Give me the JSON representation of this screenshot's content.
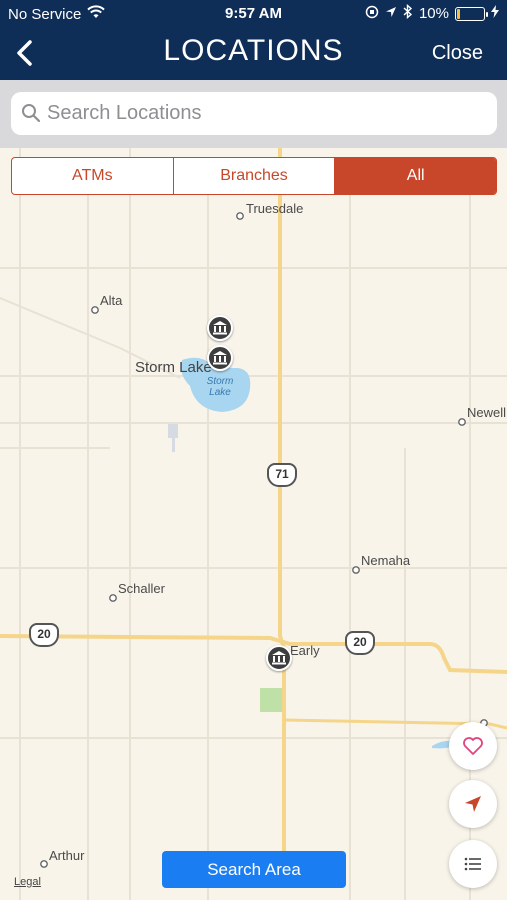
{
  "status_bar": {
    "carrier": "No Service",
    "time": "9:57 AM",
    "battery": "10%",
    "battery_level": 0.1
  },
  "nav": {
    "title": "LOCATIONS",
    "close_label": "Close"
  },
  "search": {
    "placeholder": "Search Locations"
  },
  "filter": {
    "options": [
      "ATMs",
      "Branches",
      "All"
    ],
    "selected": "All"
  },
  "map": {
    "places": [
      "Truesdale",
      "Alta",
      "Storm Lake",
      "Newell",
      "Nemaha",
      "Schaller",
      "Early",
      "Arthur"
    ],
    "lake_label": [
      "Storm",
      "Lake"
    ],
    "routes": [
      "71",
      "20",
      "20"
    ],
    "legal": "Legal"
  },
  "buttons": {
    "search_area": "Search Area",
    "favorites_icon": "heart-icon",
    "locate_icon": "location-arrow-icon",
    "list_icon": "list-icon"
  },
  "colors": {
    "nav_bg": "#0f2e57",
    "accent": "#c8472a",
    "search_area": "#1a7ef2",
    "map_bg": "#f8f4ea"
  }
}
